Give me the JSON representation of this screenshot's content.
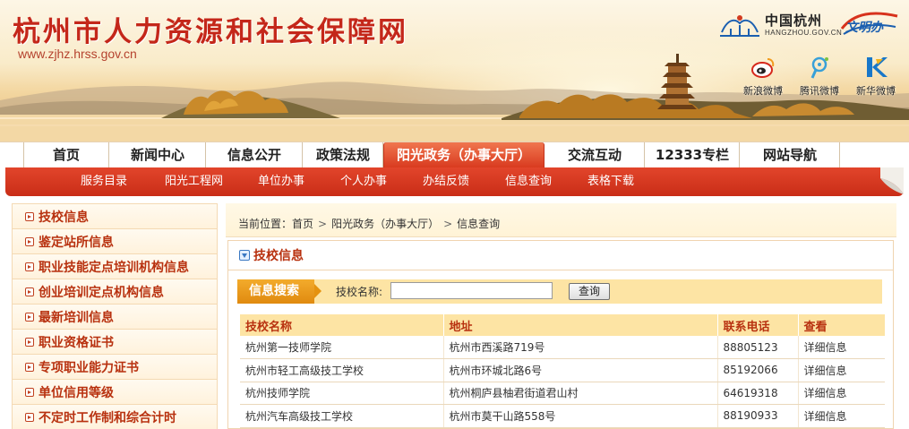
{
  "header": {
    "site_title": "杭州市人力资源和社会保障网",
    "site_url": "www.zjhz.hrss.gov.cn",
    "logo_hangzhou_cn": "中国杭州",
    "logo_hangzhou_en": "HANGZHOU.GOV.CN",
    "logo_wenming_text": "文明办",
    "social": [
      {
        "label": "新浪微博",
        "icon": "sina-weibo-icon"
      },
      {
        "label": "腾讯微博",
        "icon": "tencent-weibo-icon"
      },
      {
        "label": "新华微博",
        "icon": "xinhua-weibo-icon"
      }
    ]
  },
  "main_nav": [
    "首页",
    "新闻中心",
    "信息公开",
    "政策法规",
    "阳光政务（办事大厅）",
    "交流互动",
    "12333专栏",
    "网站导航"
  ],
  "main_nav_active": "阳光政务（办事大厅）",
  "sub_nav": [
    "服务目录",
    "阳光工程网",
    "单位办事",
    "个人办事",
    "办结反馈",
    "信息查询",
    "表格下载"
  ],
  "sidebar": [
    "技校信息",
    "鉴定站所信息",
    "职业技能定点培训机构信息",
    "创业培训定点机构信息",
    "最新培训信息",
    "职业资格证书",
    "专项职业能力证书",
    "单位信用等级",
    "不定时工作制和综合计时"
  ],
  "breadcrumb": {
    "prefix": "当前位置：",
    "items": [
      "首页",
      "阳光政务（办事大厅）",
      "信息查询"
    ],
    "separator": ">"
  },
  "panel": {
    "title": "技校信息",
    "search_tag": "信息搜索",
    "search_label": "技校名称:",
    "search_value": "",
    "search_placeholder": "",
    "search_button": "查询"
  },
  "table": {
    "headers": [
      "技校名称",
      "地址",
      "联系电话",
      "查看"
    ],
    "rows": [
      [
        "杭州第一技师学院",
        "杭州市西溪路719号",
        "88805123",
        "详细信息"
      ],
      [
        "杭州市轻工高级技工学校",
        "杭州市环城北路6号",
        "85192066",
        "详细信息"
      ],
      [
        "杭州技师学院",
        "杭州桐庐县柚君街道君山村",
        "64619318",
        "详细信息"
      ],
      [
        "杭州汽车高级技工学校",
        "杭州市莫干山路558号",
        "88190933",
        "详细信息"
      ]
    ]
  },
  "colors": {
    "brand_red": "#c4271a",
    "nav_red": "#d8391e",
    "accent_orange": "#e08a0f",
    "table_header_bg": "#fde4a4"
  }
}
